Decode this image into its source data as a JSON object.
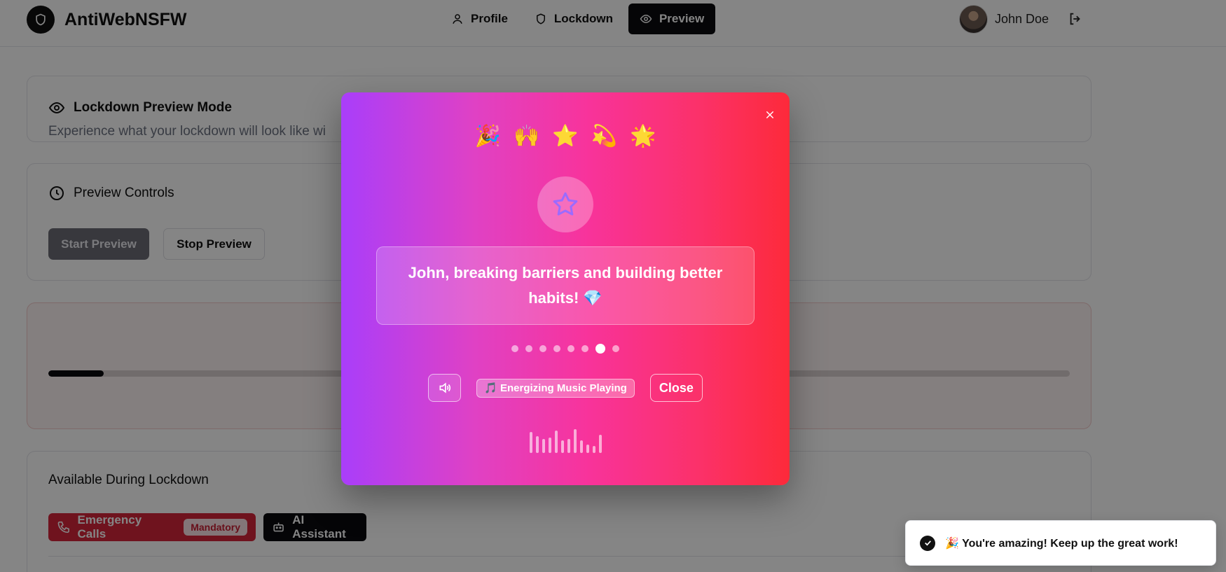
{
  "app": {
    "name": "AntiWebNSFW",
    "logo_icon": "shield-icon"
  },
  "nav": {
    "tabs": [
      {
        "label": "Profile",
        "icon": "user-icon",
        "active": false
      },
      {
        "label": "Lockdown",
        "icon": "shield-icon",
        "active": false
      },
      {
        "label": "Preview",
        "icon": "eye-icon",
        "active": true
      }
    ]
  },
  "user": {
    "name": "John Doe",
    "logout_icon": "logout-icon"
  },
  "preview_mode": {
    "title": "Lockdown Preview Mode",
    "subtitle": "Experience what your lockdown will look like wi"
  },
  "preview_controls": {
    "title": "Preview Controls",
    "start_label": "Start Preview",
    "stop_label": "Stop Preview"
  },
  "preview_progress": {
    "value": 0.054
  },
  "available": {
    "title": "Available During Lockdown",
    "emergency_label": "Emergency Calls",
    "emergency_badge": "Mandatory",
    "ai_label": "AI Assistant"
  },
  "modal": {
    "emojis": [
      "🎉",
      "🙌",
      "⭐",
      "💫",
      "🌟"
    ],
    "message": "John, breaking barriers and building better habits! 💎",
    "dots_total": 8,
    "dots_active_index": 6,
    "music_label": "🎵 Energizing Music Playing",
    "close_label": "Close",
    "eq_levels": [
      0.75,
      0.6,
      0.5,
      0.55,
      0.8,
      0.45,
      0.5,
      0.85,
      0.45,
      0.3,
      0.25,
      0.65
    ]
  },
  "toast": {
    "text": "🎉 You're amazing! Keep up the great work!"
  },
  "colors": {
    "accent": "#0b0b0f",
    "emergency": "#d5253a",
    "modal_gradient_start": "#a93efa",
    "modal_gradient_end": "#fd2a3a"
  }
}
